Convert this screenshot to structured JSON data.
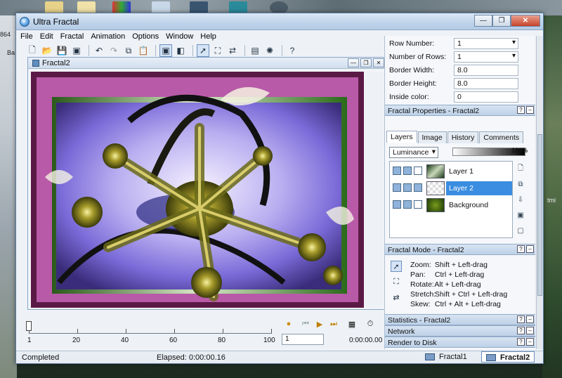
{
  "desktop": {
    "left_labels": [
      "864",
      "Ba"
    ],
    "right_label": "tmi"
  },
  "window": {
    "title": "Ultra Fractal"
  },
  "menu": [
    "File",
    "Edit",
    "Fractal",
    "Animation",
    "Options",
    "Window",
    "Help"
  ],
  "document": {
    "title": "Fractal2"
  },
  "timeline": {
    "ticks": [
      "1",
      "20",
      "40",
      "60",
      "80",
      "100"
    ],
    "frame": "1",
    "time": "0:00:00.00"
  },
  "status": {
    "left": "Completed",
    "elapsed": "Elapsed: 0:00:00.16",
    "tabs": [
      "Fractal1",
      "Fractal2"
    ]
  },
  "properties": {
    "row_number_label": "Row Number:",
    "row_number": "1",
    "num_rows_label": "Number of Rows:",
    "num_rows": "1",
    "border_width_label": "Border Width:",
    "border_width": "8.0",
    "border_height_label": "Border Height:",
    "border_height": "8.0",
    "inside_color_label": "Inside color:",
    "inside_color": "0"
  },
  "fractal_props": {
    "header": "Fractal Properties - Fractal2",
    "tabs": [
      "Layers",
      "Image",
      "History",
      "Comments"
    ],
    "blend_mode": "Luminance",
    "opacity": "100%",
    "layers": [
      "Layer 1",
      "Layer 2",
      "Background"
    ]
  },
  "fractal_mode": {
    "header": "Fractal Mode - Fractal2",
    "rows": [
      {
        "key": "Zoom:",
        "value": "Shift + Left-drag"
      },
      {
        "key": "Pan:",
        "value": "Ctrl + Left-drag"
      },
      {
        "key": "Rotate:",
        "value": "Alt + Left-drag"
      },
      {
        "key": "Stretch:",
        "value": "Shift + Ctrl + Left-drag"
      },
      {
        "key": "Skew:",
        "value": "Ctrl + Alt + Left-drag"
      }
    ]
  },
  "panels": {
    "statistics": "Statistics - Fractal2",
    "network": "Network",
    "render": "Render to Disk"
  }
}
